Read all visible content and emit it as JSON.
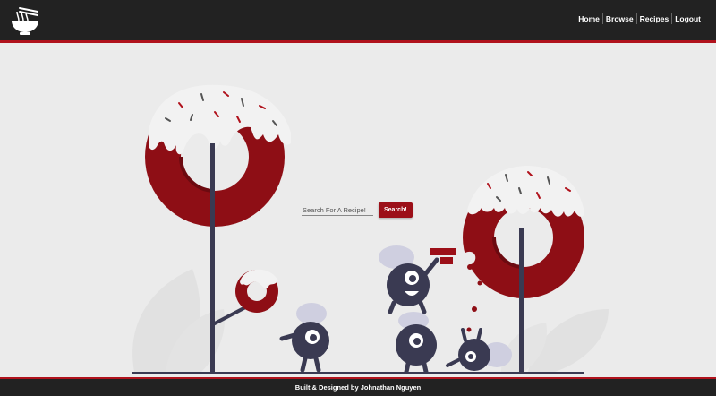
{
  "nav": {
    "links": [
      "Home",
      "Browse",
      "Recipes",
      "Logout"
    ]
  },
  "icons": {
    "logo": "noodle-bowl-icon"
  },
  "search": {
    "placeholder": "Search For A Recipe!",
    "button_label": "Search!"
  },
  "footer": {
    "text": "Built & Designed by Johnathan Nguyen"
  },
  "colors": {
    "nav_bg": "#222222",
    "accent": "#b0121c",
    "donut": "#9c0f18",
    "page_bg": "#ebebeb",
    "creature": "#3a3a52",
    "frosting": "#f2f2f2"
  }
}
